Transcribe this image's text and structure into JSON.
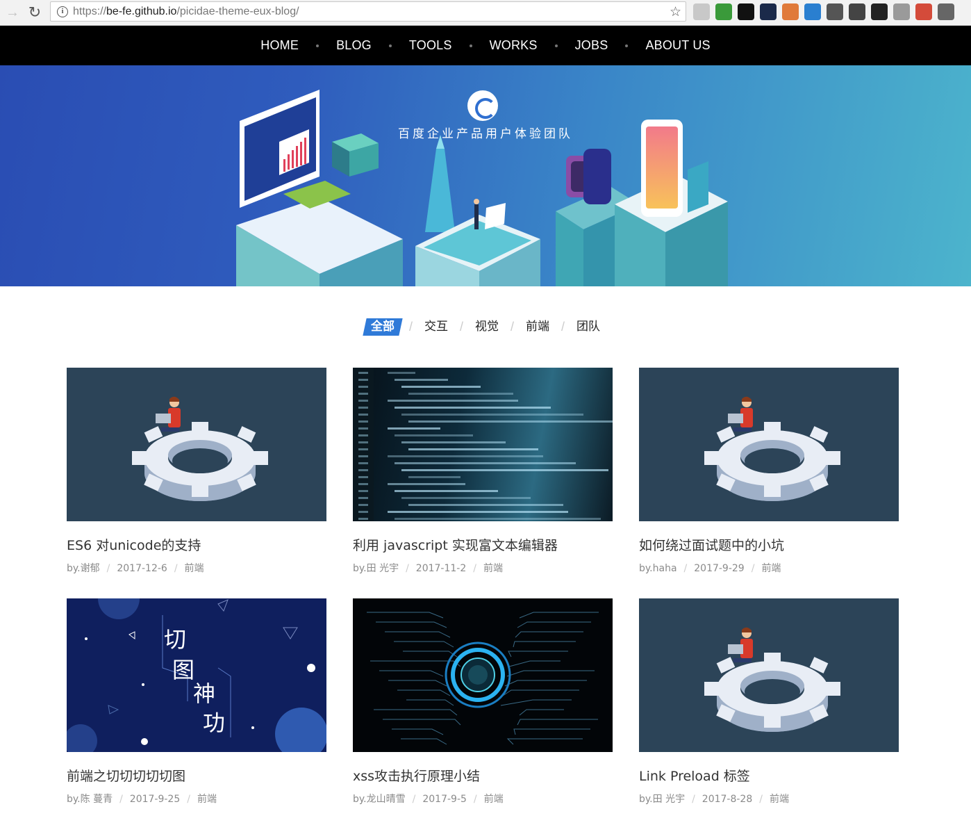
{
  "browser": {
    "url_scheme": "https://",
    "url_host": "be-fe.github.io",
    "url_path": "/picidae-theme-eux-blog/",
    "extensions": [
      {
        "icon": "tab-icon",
        "color": "#c8c8c8"
      },
      {
        "icon": "shield-icon",
        "color": "#3a9a3a"
      },
      {
        "icon": "circle-icon",
        "color": "#111111"
      },
      {
        "icon": "react-icon",
        "color": "#1b2a4a"
      },
      {
        "icon": "fox-icon",
        "color": "#e07a3a"
      },
      {
        "icon": "s-icon",
        "color": "#2a7fd0"
      },
      {
        "icon": "image-icon",
        "color": "#555555"
      },
      {
        "icon": "bracket-icon",
        "color": "#444444"
      },
      {
        "icon": "function-icon",
        "color": "#222222"
      },
      {
        "icon": "s-icon",
        "color": "#9a9a9a"
      },
      {
        "icon": "google-icon",
        "color": "#d44b3a"
      },
      {
        "icon": "github-icon",
        "color": "#666666"
      }
    ]
  },
  "nav": {
    "items": [
      "HOME",
      "BLOG",
      "TOOLS",
      "WORKS",
      "JOBS",
      "ABOUT US"
    ]
  },
  "banner": {
    "title": "百度企业产品用户体验团队"
  },
  "tabs": [
    "全部",
    "交互",
    "视觉",
    "前端",
    "团队"
  ],
  "posts": [
    {
      "title": "ES6 对unicode的支持",
      "author": "by.谢郁",
      "date": "2017-12-6",
      "category": "前端",
      "thumb": "gear"
    },
    {
      "title": "利用 javascript 实现富文本编辑器",
      "author": "by.田 光宇",
      "date": "2017-11-2",
      "category": "前端",
      "thumb": "code"
    },
    {
      "title": "如何绕过面试题中的小坑",
      "author": "by.haha",
      "date": "2017-9-29",
      "category": "前端",
      "thumb": "gear"
    },
    {
      "title": "前端之切切切切切图",
      "author": "by.陈 蔓青",
      "date": "2017-9-25",
      "category": "前端",
      "thumb": "space",
      "thumb_text": [
        "切",
        "图",
        "神",
        "功"
      ]
    },
    {
      "title": "xss攻击执行原理小结",
      "author": "by.龙山晴雪",
      "date": "2017-9-5",
      "category": "前端",
      "thumb": "circuit"
    },
    {
      "title": "Link Preload 标签",
      "author": "by.田 光宇",
      "date": "2017-8-28",
      "category": "前端",
      "thumb": "gear"
    }
  ]
}
